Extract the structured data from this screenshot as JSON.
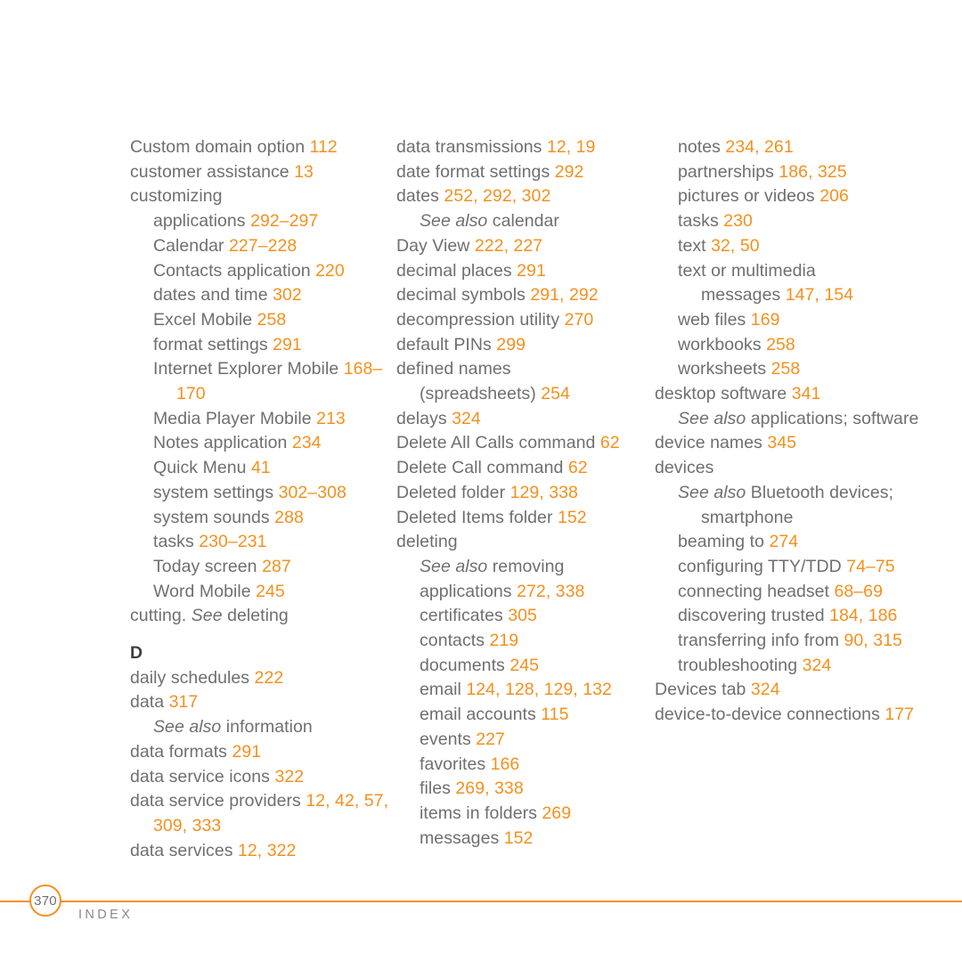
{
  "document": {
    "type": "book-index-page",
    "page_number": "370",
    "footer_label": "INDEX",
    "accent_color": "#f5901e",
    "text_color": "#6f6f6f"
  },
  "columns": [
    {
      "id": "column-1",
      "blocks": [
        {
          "kind": "entry",
          "indent": 0,
          "text": "Custom domain option ",
          "pages": "112"
        },
        {
          "kind": "entry",
          "indent": 0,
          "text": "customer assistance ",
          "pages": "13"
        },
        {
          "kind": "entry",
          "indent": 0,
          "text": "customizing",
          "pages": ""
        },
        {
          "kind": "entry",
          "indent": 1,
          "text": "applications ",
          "pages": "292–297"
        },
        {
          "kind": "entry",
          "indent": 1,
          "text": "Calendar ",
          "pages": "227–228"
        },
        {
          "kind": "entry",
          "indent": 1,
          "text": "Contacts application ",
          "pages": "220"
        },
        {
          "kind": "entry",
          "indent": 1,
          "text": "dates and time ",
          "pages": "302"
        },
        {
          "kind": "entry",
          "indent": 1,
          "text": "Excel Mobile ",
          "pages": "258"
        },
        {
          "kind": "entry",
          "indent": 1,
          "text": "format settings ",
          "pages": "291"
        },
        {
          "kind": "entry",
          "indent": 1,
          "hang": true,
          "text": "Internet Explorer Mobile ",
          "pages": "168–170"
        },
        {
          "kind": "entry",
          "indent": 1,
          "text": "Media Player Mobile ",
          "pages": "213"
        },
        {
          "kind": "entry",
          "indent": 1,
          "text": "Notes application ",
          "pages": "234"
        },
        {
          "kind": "entry",
          "indent": 1,
          "text": "Quick Menu ",
          "pages": "41"
        },
        {
          "kind": "entry",
          "indent": 1,
          "text": "system settings ",
          "pages": "302–308"
        },
        {
          "kind": "entry",
          "indent": 1,
          "text": "system sounds ",
          "pages": "288"
        },
        {
          "kind": "entry",
          "indent": 1,
          "text": "tasks ",
          "pages": "230–231"
        },
        {
          "kind": "entry",
          "indent": 1,
          "text": "Today screen ",
          "pages": "287"
        },
        {
          "kind": "entry",
          "indent": 1,
          "text": "Word Mobile ",
          "pages": "245"
        },
        {
          "kind": "crossref",
          "indent": 0,
          "pre": "cutting. ",
          "see": "See",
          "post": " deleting"
        },
        {
          "kind": "letter",
          "text": "D"
        },
        {
          "kind": "entry",
          "indent": 0,
          "text": "daily schedules ",
          "pages": "222"
        },
        {
          "kind": "entry",
          "indent": 0,
          "text": "data ",
          "pages": "317"
        },
        {
          "kind": "crossref",
          "indent": 1,
          "pre": "",
          "see": "See also",
          "post": " information"
        },
        {
          "kind": "entry",
          "indent": 0,
          "text": "data formats ",
          "pages": "291"
        },
        {
          "kind": "entry",
          "indent": 0,
          "text": "data service icons ",
          "pages": "322"
        },
        {
          "kind": "entry",
          "indent": 0,
          "hang": true,
          "text": "data service providers ",
          "pages": "12, 42, 57, 309, 333"
        },
        {
          "kind": "entry",
          "indent": 0,
          "text": "data services ",
          "pages": "12, 322"
        }
      ]
    },
    {
      "id": "column-2",
      "blocks": [
        {
          "kind": "entry",
          "indent": 0,
          "text": "data transmissions ",
          "pages": "12, 19"
        },
        {
          "kind": "entry",
          "indent": 0,
          "text": "date format settings ",
          "pages": "292"
        },
        {
          "kind": "entry",
          "indent": 0,
          "text": "dates ",
          "pages": "252, 292, 302"
        },
        {
          "kind": "crossref",
          "indent": 1,
          "pre": "",
          "see": "See also",
          "post": " calendar"
        },
        {
          "kind": "entry",
          "indent": 0,
          "text": "Day View ",
          "pages": "222, 227"
        },
        {
          "kind": "entry",
          "indent": 0,
          "text": "decimal places ",
          "pages": "291"
        },
        {
          "kind": "entry",
          "indent": 0,
          "text": "decimal symbols ",
          "pages": "291, 292"
        },
        {
          "kind": "entry",
          "indent": 0,
          "text": "decompression utility ",
          "pages": "270"
        },
        {
          "kind": "entry",
          "indent": 0,
          "text": "default PINs ",
          "pages": "299"
        },
        {
          "kind": "entry",
          "indent": 0,
          "text": "defined names",
          "pages": ""
        },
        {
          "kind": "entry",
          "indent": 1,
          "text": "(spreadsheets) ",
          "pages": "254"
        },
        {
          "kind": "entry",
          "indent": 0,
          "text": "delays ",
          "pages": "324"
        },
        {
          "kind": "entry",
          "indent": 0,
          "text": "Delete All Calls command ",
          "pages": "62"
        },
        {
          "kind": "entry",
          "indent": 0,
          "text": "Delete Call command ",
          "pages": "62"
        },
        {
          "kind": "entry",
          "indent": 0,
          "text": "Deleted folder ",
          "pages": "129, 338"
        },
        {
          "kind": "entry",
          "indent": 0,
          "text": "Deleted Items folder ",
          "pages": "152"
        },
        {
          "kind": "entry",
          "indent": 0,
          "text": "deleting",
          "pages": ""
        },
        {
          "kind": "crossref",
          "indent": 1,
          "pre": "",
          "see": "See also",
          "post": " removing"
        },
        {
          "kind": "entry",
          "indent": 1,
          "text": "applications ",
          "pages": "272, 338"
        },
        {
          "kind": "entry",
          "indent": 1,
          "text": "certificates ",
          "pages": "305"
        },
        {
          "kind": "entry",
          "indent": 1,
          "text": "contacts ",
          "pages": "219"
        },
        {
          "kind": "entry",
          "indent": 1,
          "text": "documents ",
          "pages": "245"
        },
        {
          "kind": "entry",
          "indent": 1,
          "text": "email ",
          "pages": "124, 128, 129, 132"
        },
        {
          "kind": "entry",
          "indent": 1,
          "text": "email accounts ",
          "pages": "115"
        },
        {
          "kind": "entry",
          "indent": 1,
          "text": "events ",
          "pages": "227"
        },
        {
          "kind": "entry",
          "indent": 1,
          "text": "favorites ",
          "pages": "166"
        },
        {
          "kind": "entry",
          "indent": 1,
          "text": "files ",
          "pages": "269, 338"
        },
        {
          "kind": "entry",
          "indent": 1,
          "text": "items in folders ",
          "pages": "269"
        },
        {
          "kind": "entry",
          "indent": 1,
          "text": "messages ",
          "pages": "152"
        }
      ]
    },
    {
      "id": "column-3",
      "blocks": [
        {
          "kind": "entry",
          "indent": 1,
          "text": "notes ",
          "pages": "234, 261"
        },
        {
          "kind": "entry",
          "indent": 1,
          "text": "partnerships ",
          "pages": "186, 325"
        },
        {
          "kind": "entry",
          "indent": 1,
          "text": "pictures or videos ",
          "pages": "206"
        },
        {
          "kind": "entry",
          "indent": 1,
          "text": "tasks ",
          "pages": "230"
        },
        {
          "kind": "entry",
          "indent": 1,
          "text": "text ",
          "pages": "32, 50"
        },
        {
          "kind": "entry",
          "indent": 1,
          "text": "text or multimedia",
          "pages": ""
        },
        {
          "kind": "entry",
          "indent": 2,
          "text": "messages ",
          "pages": "147, 154"
        },
        {
          "kind": "entry",
          "indent": 1,
          "text": "web files ",
          "pages": "169"
        },
        {
          "kind": "entry",
          "indent": 1,
          "text": "workbooks ",
          "pages": "258"
        },
        {
          "kind": "entry",
          "indent": 1,
          "text": "worksheets ",
          "pages": "258"
        },
        {
          "kind": "entry",
          "indent": 0,
          "text": "desktop software ",
          "pages": "341"
        },
        {
          "kind": "crossref",
          "indent": 1,
          "hang": true,
          "pre": "",
          "see": "See also",
          "post": " applications; software"
        },
        {
          "kind": "entry",
          "indent": 0,
          "text": "device names ",
          "pages": "345"
        },
        {
          "kind": "entry",
          "indent": 0,
          "text": "devices",
          "pages": ""
        },
        {
          "kind": "crossref",
          "indent": 1,
          "hang": true,
          "pre": "",
          "see": "See also",
          "post": " Bluetooth devices; smartphone"
        },
        {
          "kind": "entry",
          "indent": 1,
          "text": "beaming to ",
          "pages": "274"
        },
        {
          "kind": "entry",
          "indent": 1,
          "hang": true,
          "text": "configuring TTY/TDD ",
          "pages": "74–75"
        },
        {
          "kind": "entry",
          "indent": 1,
          "text": "connecting headset ",
          "pages": "68–69"
        },
        {
          "kind": "entry",
          "indent": 1,
          "hang": true,
          "text": "discovering trusted ",
          "pages": "184, 186"
        },
        {
          "kind": "entry",
          "indent": 1,
          "hang": true,
          "text": "transferring info from ",
          "pages": "90, 315"
        },
        {
          "kind": "entry",
          "indent": 1,
          "text": "troubleshooting ",
          "pages": "324"
        },
        {
          "kind": "entry",
          "indent": 0,
          "text": "Devices tab ",
          "pages": "324"
        },
        {
          "kind": "entry",
          "indent": 0,
          "hang": true,
          "text": "device-to-device connections ",
          "pages": "177"
        }
      ]
    }
  ]
}
